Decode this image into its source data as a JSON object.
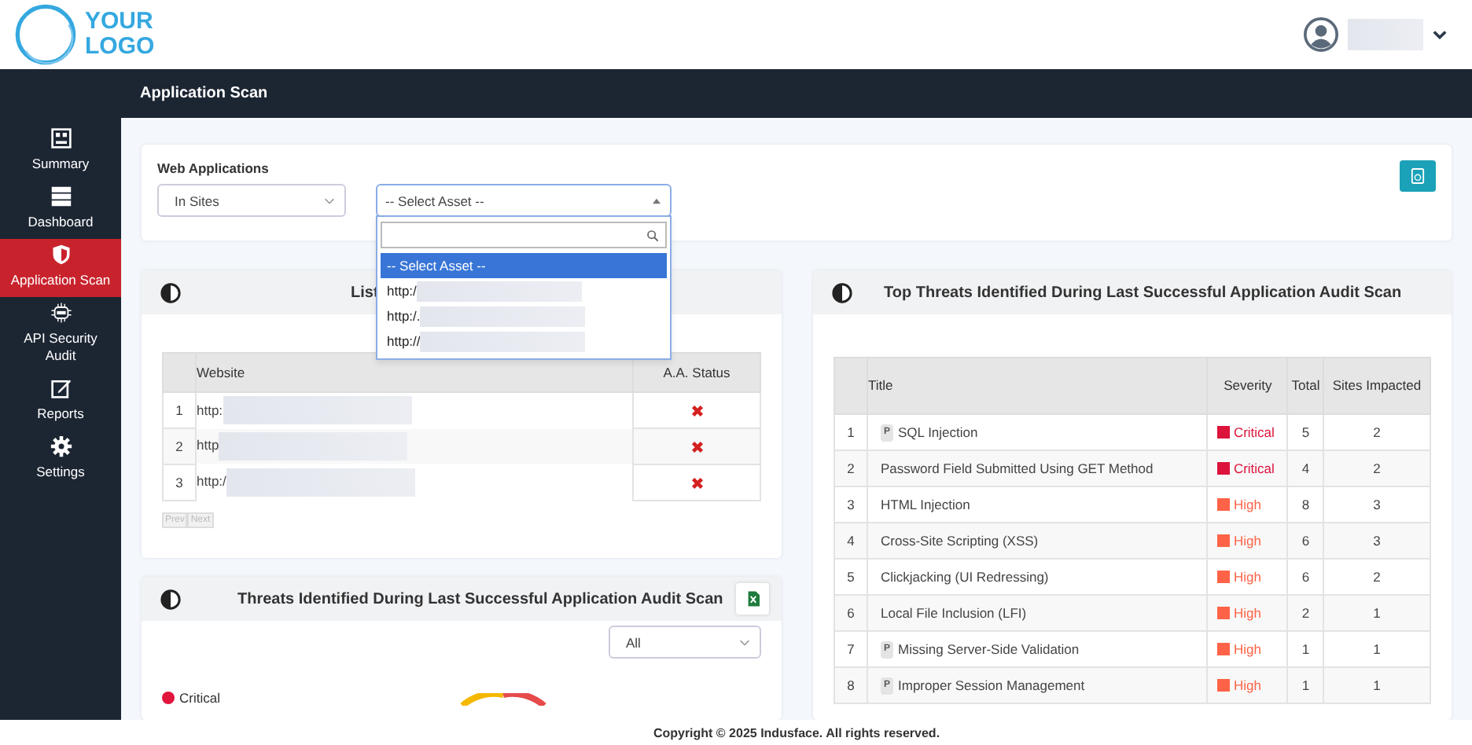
{
  "logo": {
    "line1": "YOUR",
    "line2": "LOGO"
  },
  "user": {
    "name_hidden": true
  },
  "page_title": "Application Scan",
  "sidebar": {
    "items": [
      {
        "label": "Summary",
        "selected": false
      },
      {
        "label": "Dashboard",
        "selected": false
      },
      {
        "label": "Application Scan",
        "selected": true
      },
      {
        "label": "API Security Audit",
        "selected": false
      },
      {
        "label": "Reports",
        "selected": false
      },
      {
        "label": "Settings",
        "selected": false
      }
    ]
  },
  "filters": {
    "label": "Web Applications",
    "type_select": "In Sites",
    "asset_select": {
      "value": "-- Select Asset --",
      "expanded": true,
      "options": [
        {
          "label": "-- Select Asset --",
          "selected": true
        },
        {
          "label": "http:/",
          "selected": false
        },
        {
          "label": "http:/.",
          "selected": false
        },
        {
          "label": "http://",
          "selected": false
        }
      ]
    }
  },
  "apps_card": {
    "title": "List",
    "columns": [
      "Website",
      "A.A. Status"
    ],
    "rows": [
      {
        "index": "1",
        "url": "http:",
        "failed": true
      },
      {
        "index": "2",
        "url": "http",
        "failed": true
      },
      {
        "index": "3",
        "url": "http:/",
        "failed": true
      }
    ],
    "pager": [
      "Prev",
      "Next"
    ]
  },
  "threats_card": {
    "title": "Threats Identified During Last Successful Application Audit Scan",
    "filter": "All",
    "legend": [
      {
        "label": "Critical",
        "color": "#e0143c"
      }
    ]
  },
  "top_threats": {
    "title": "Top Threats Identified During Last Successful Application Audit Scan",
    "columns": [
      "Title",
      "Severity",
      "Total",
      "Sites Impacted"
    ],
    "rows": [
      {
        "index": "1",
        "tag": "P",
        "title": "SQL Injection",
        "severity": "Critical",
        "color": "#dc143c",
        "total": "5",
        "sites": "2"
      },
      {
        "index": "2",
        "title": "Password Field Submitted Using GET Method",
        "severity": "Critical",
        "color": "#dc143c",
        "total": "4",
        "sites": "2"
      },
      {
        "index": "3",
        "title": "HTML Injection",
        "severity": "High",
        "color": "#ff6347",
        "total": "8",
        "sites": "3"
      },
      {
        "index": "4",
        "title": "Cross-Site Scripting (XSS)",
        "severity": "High",
        "color": "#ff6347",
        "total": "6",
        "sites": "3"
      },
      {
        "index": "5",
        "title": "Clickjacking (UI Redressing)",
        "severity": "High",
        "color": "#ff6347",
        "total": "6",
        "sites": "2"
      },
      {
        "index": "6",
        "title": "Local File Inclusion (LFI)",
        "severity": "High",
        "color": "#ff6347",
        "total": "2",
        "sites": "1"
      },
      {
        "index": "7",
        "tag": "P",
        "title": "Missing Server-Side Validation",
        "severity": "High",
        "color": "#ff6347",
        "total": "1",
        "sites": "1"
      },
      {
        "index": "8",
        "tag": "P",
        "title": "Improper Session Management",
        "severity": "High",
        "color": "#ff6347",
        "total": "1",
        "sites": "1"
      }
    ]
  },
  "footer": "Copyright © 2025 Indusface. All rights reserved."
}
